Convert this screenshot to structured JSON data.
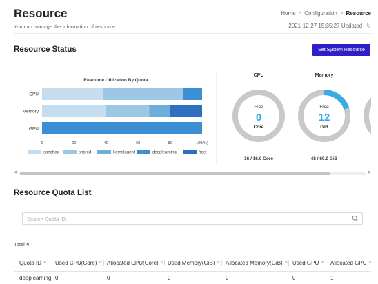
{
  "header": {
    "title": "Resource",
    "description": "You can manage the information of resource.",
    "breadcrumb": [
      "Home",
      "Configuration",
      "Resource"
    ],
    "breadcrumb_sep": ">",
    "updated_time": "2021-12-27 15:35:27",
    "updated_label": "Updated"
  },
  "status": {
    "title": "Resource Status",
    "button": "Set System Resource"
  },
  "chart_data": {
    "type": "bar",
    "orientation": "horizontal",
    "stacked": true,
    "title": "Resource Utilization By Quota",
    "categories": [
      "CPU",
      "Memory",
      "GPU"
    ],
    "xticks": [
      "0",
      "20",
      "40",
      "60",
      "80",
      "100(%)"
    ],
    "xlim": [
      0,
      100
    ],
    "series": [
      {
        "name": "sandbox",
        "color": "#c6dcef",
        "values": [
          38,
          40,
          0
        ]
      },
      {
        "name": "shared",
        "color": "#9cc8e4",
        "values": [
          50,
          27,
          0
        ]
      },
      {
        "name": "kernelagent",
        "color": "#6dafdb",
        "values": [
          0,
          13,
          0
        ]
      },
      {
        "name": "deeplearning",
        "color": "#3d8fd4",
        "values": [
          12,
          0,
          100
        ]
      },
      {
        "name": "free",
        "color": "#2e6fc0",
        "values": [
          0,
          20,
          0
        ]
      }
    ],
    "legend": "bottom",
    "grid": false
  },
  "gauges": [
    {
      "title": "CPU",
      "free_label": "Free",
      "value": "0",
      "unit": "Core",
      "footer": "16 / 16.0 Core",
      "used_fraction": 1.0
    },
    {
      "title": "Memory",
      "free_label": "Free",
      "value": "12",
      "unit": "GiB",
      "footer": "48 / 60.0 GiB",
      "used_fraction": 0.8
    }
  ],
  "quota": {
    "title": "Resource Quota List",
    "search_placeholder": "Search Quota ID.",
    "total_label": "Total",
    "total_value": "4",
    "columns": [
      "Quota ID",
      "Used CPU(Core)",
      "Allocated CPU(Core)",
      "Used Memory(GiB)",
      "Allocated Memory(GiB)",
      "Used GPU",
      "Allocated GPU"
    ],
    "rows": [
      [
        "deeplearning",
        "0",
        "0",
        "0",
        "0",
        "0",
        "1"
      ]
    ]
  },
  "colors": {
    "accent_button": "#2e1fc9",
    "gauge_used": "#c9c9c9",
    "gauge_free": "#3aaae5",
    "gauge_value": "#35a6e6"
  }
}
